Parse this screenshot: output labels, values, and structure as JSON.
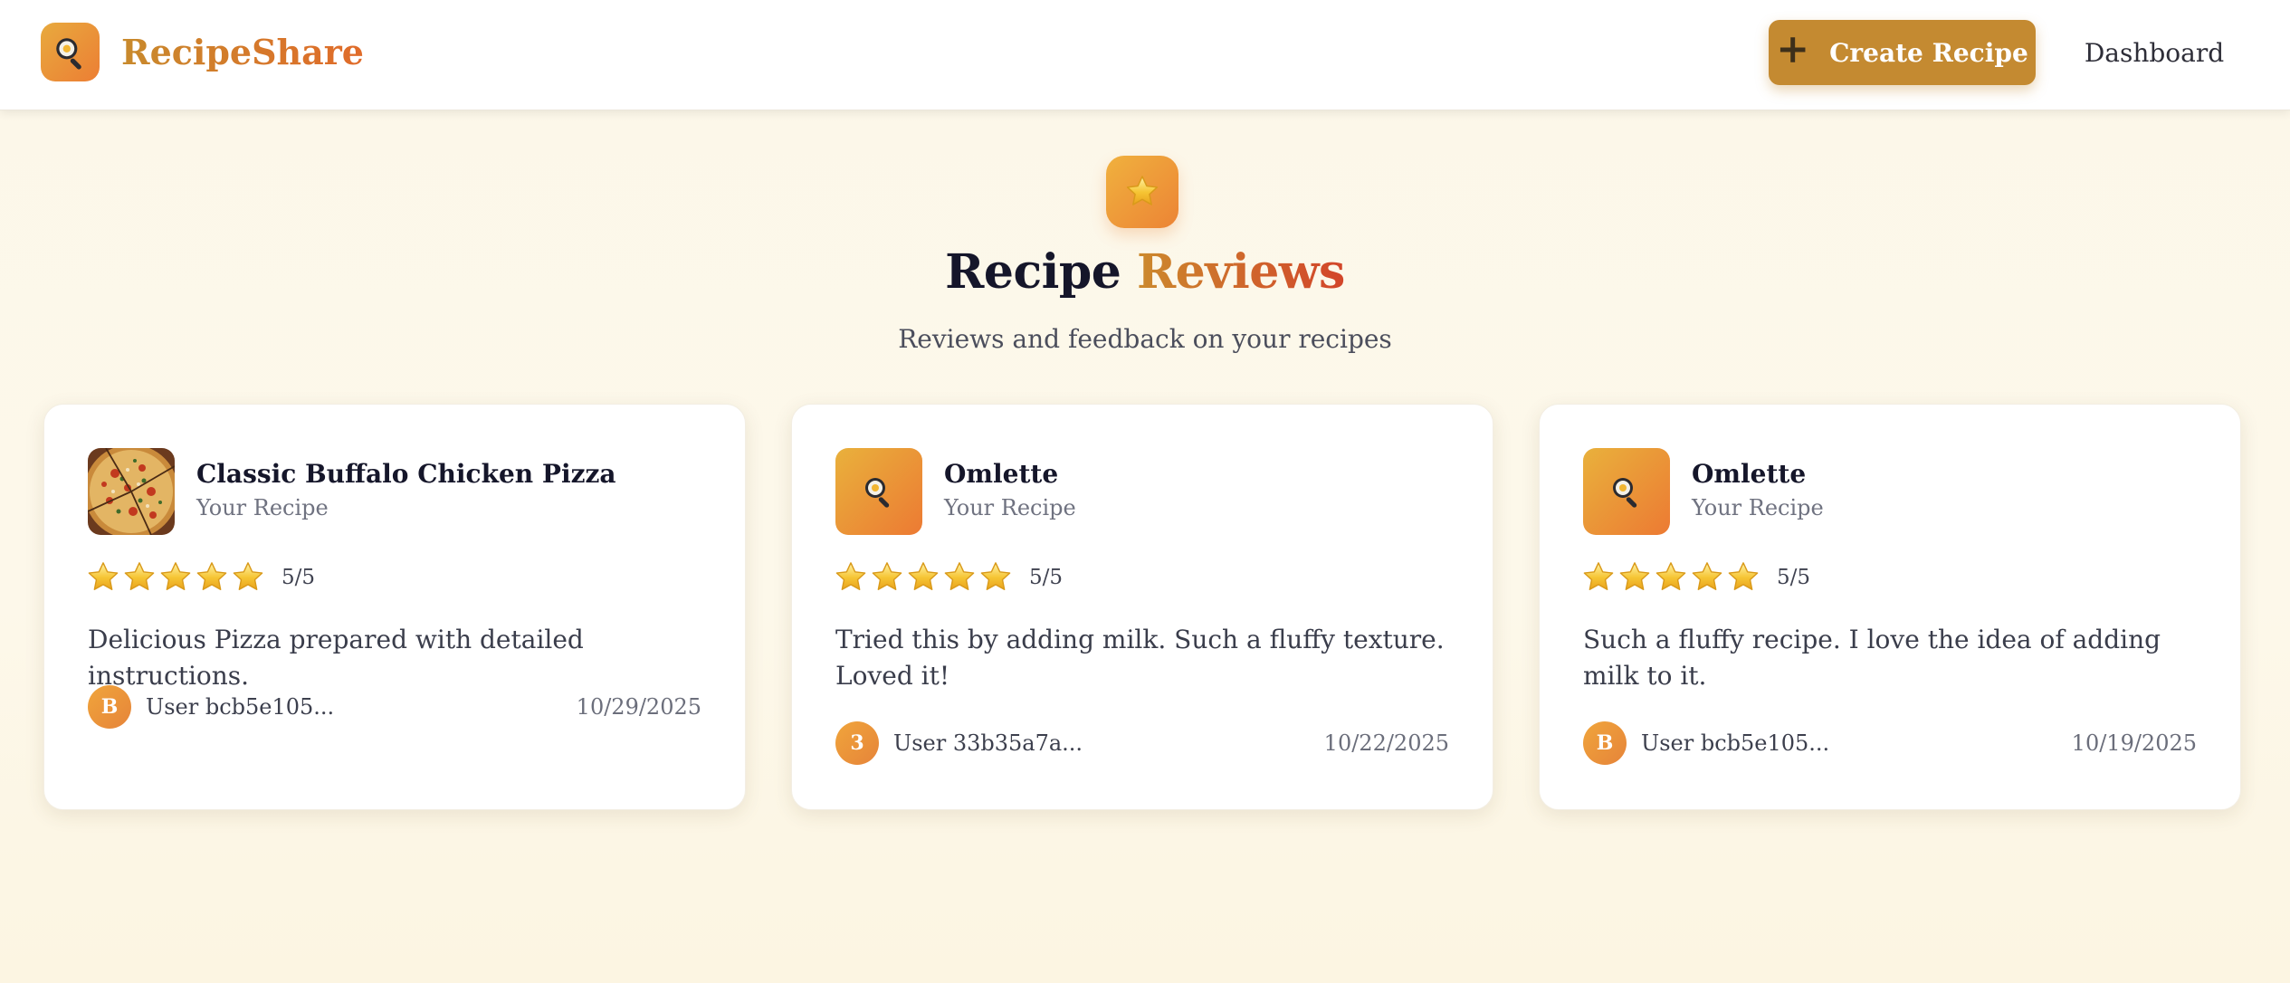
{
  "app": {
    "name": "RecipeShare",
    "logo_icon": "magnifier-pan-icon"
  },
  "header": {
    "create_label": "Create Recipe",
    "create_icon": "plus-icon",
    "dashboard_label": "Dashboard"
  },
  "hero": {
    "icon": "star-icon",
    "title_main": "Recipe ",
    "title_accent": "Reviews",
    "subtitle": "Reviews and feedback on your recipes"
  },
  "colors": {
    "brand": "#c48a31",
    "accent_orange": "#ec7e34",
    "star": "#f5c233"
  },
  "reviews": [
    {
      "recipe_title": "Classic Buffalo Chicken Pizza",
      "owner_label": "Your Recipe",
      "thumbnail": "pizza-photo",
      "rating": 5,
      "rating_text": "5/5",
      "text": "Delicious Pizza prepared with detailed instructions.",
      "avatar_initial": "B",
      "user": "User bcb5e105...",
      "date": "10/29/2025"
    },
    {
      "recipe_title": "Omlette",
      "owner_label": "Your Recipe",
      "thumbnail": "magnifier-pan-icon",
      "rating": 5,
      "rating_text": "5/5",
      "text": "Tried this by adding milk. Such a fluffy texture. Loved it!",
      "avatar_initial": "3",
      "user": "User 33b35a7a...",
      "date": "10/22/2025"
    },
    {
      "recipe_title": "Omlette",
      "owner_label": "Your Recipe",
      "thumbnail": "magnifier-pan-icon",
      "rating": 5,
      "rating_text": "5/5",
      "text": "Such a fluffy recipe. I love the idea of adding milk to it.",
      "avatar_initial": "B",
      "user": "User bcb5e105...",
      "date": "10/19/2025"
    }
  ]
}
